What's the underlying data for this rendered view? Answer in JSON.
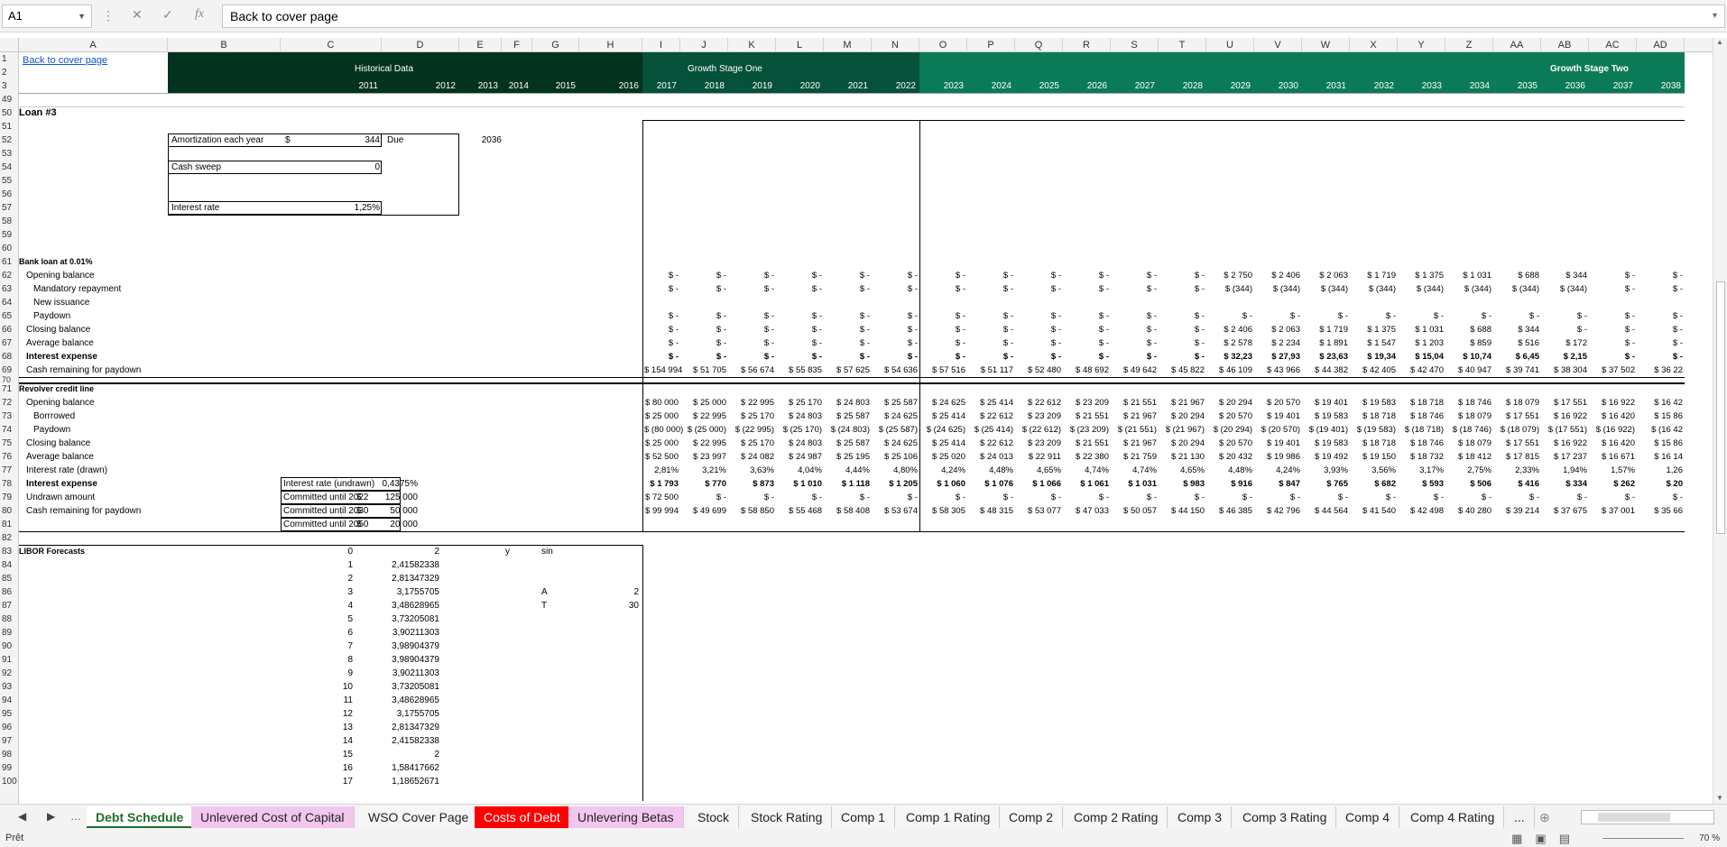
{
  "formula_bar": {
    "name_box": "A1",
    "formula": "Back to cover page"
  },
  "columns": [
    "A",
    "B",
    "C",
    "D",
    "E",
    "F",
    "G",
    "H",
    "I",
    "J",
    "K",
    "L",
    "M",
    "N",
    "O",
    "P",
    "Q",
    "R",
    "S",
    "T",
    "U",
    "V",
    "W",
    "X",
    "Y",
    "Z",
    "AA",
    "AB",
    "AC",
    "AD"
  ],
  "rows": [
    "1",
    "2",
    "3",
    "49",
    "50",
    "51",
    "52",
    "53",
    "54",
    "55",
    "56",
    "57",
    "58",
    "59",
    "60",
    "61",
    "62",
    "63",
    "64",
    "65",
    "66",
    "67",
    "68",
    "69",
    "70",
    "71",
    "72",
    "73",
    "74",
    "75",
    "76",
    "77",
    "78",
    "79",
    "80",
    "81",
    "82",
    "83",
    "84",
    "85",
    "86",
    "87",
    "88",
    "89",
    "90",
    "91",
    "92",
    "93",
    "94",
    "95",
    "96",
    "97",
    "98",
    "99",
    "100"
  ],
  "header": {
    "link": "Back to cover page",
    "historical": "Historical Data",
    "stage_one": "Growth Stage One",
    "stage_two": "Growth Stage Two",
    "years": [
      "2011",
      "2012",
      "2013",
      "2014",
      "2015",
      "2016",
      "2017",
      "2018",
      "2019",
      "2020",
      "2021",
      "2022",
      "2023",
      "2024",
      "2025",
      "2026",
      "2027",
      "2028",
      "2029",
      "2030",
      "2031",
      "2032",
      "2033",
      "2034",
      "2035",
      "2036",
      "2037",
      "2038"
    ]
  },
  "loan": {
    "title": "Loan #3",
    "amort_label": "Amortization each year",
    "amort_cur": "$",
    "amort_val": "344",
    "due_label": "Due",
    "due_val": "2036",
    "sweep_label": "Cash sweep",
    "sweep_val": "0",
    "rate_label": "Interest rate",
    "rate_val": "1,25%"
  },
  "bank": {
    "title": "Bank loan at 0.01%",
    "labels": [
      "Opening balance",
      "Mandatory repayment",
      "New issuance",
      "Paydown",
      "Closing balance",
      "Average balance",
      "Interest expense",
      "Cash remaining for paydown"
    ],
    "opening": [
      "$       -",
      "$       -",
      "$       -",
      "$       -",
      "$       -",
      "$       -",
      "$       -",
      "$       -",
      "$       -",
      "$       -",
      "$       -",
      "$       -",
      "$ 2 750",
      "$ 2 406",
      "$ 2 063",
      "$ 1 719",
      "$ 1 375",
      "$ 1 031",
      "$   688",
      "$   344",
      "$       -",
      "$       -"
    ],
    "mandatory": [
      "$       -",
      "$       -",
      "$       -",
      "$       -",
      "$       -",
      "$       -",
      "$       -",
      "$       -",
      "$       -",
      "$       -",
      "$       -",
      "$       -",
      "$  (344)",
      "$  (344)",
      "$  (344)",
      "$  (344)",
      "$  (344)",
      "$  (344)",
      "$  (344)",
      "$  (344)",
      "$       -",
      "$       -"
    ],
    "paydown": [
      "$       -",
      "$       -",
      "$       -",
      "$       -",
      "$       -",
      "$       -",
      "$       -",
      "$       -",
      "$       -",
      "$       -",
      "$       -",
      "$       -",
      "$       -",
      "$       -",
      "$       -",
      "$       -",
      "$       -",
      "$       -",
      "$       -",
      "$       -",
      "$       -",
      "$       -"
    ],
    "closing": [
      "$       -",
      "$       -",
      "$       -",
      "$       -",
      "$       -",
      "$       -",
      "$       -",
      "$       -",
      "$       -",
      "$       -",
      "$       -",
      "$       -",
      "$ 2 406",
      "$ 2 063",
      "$ 1 719",
      "$ 1 375",
      "$ 1 031",
      "$   688",
      "$   344",
      "$       -",
      "$       -",
      "$       -"
    ],
    "average": [
      "$       -",
      "$       -",
      "$       -",
      "$       -",
      "$       -",
      "$       -",
      "$       -",
      "$       -",
      "$       -",
      "$       -",
      "$       -",
      "$       -",
      "$ 2 578",
      "$ 2 234",
      "$ 1 891",
      "$ 1 547",
      "$ 1 203",
      "$   859",
      "$   516",
      "$   172",
      "$       -",
      "$       -"
    ],
    "interest": [
      "$       -",
      "$       -",
      "$       -",
      "$       -",
      "$       -",
      "$       -",
      "$       -",
      "$       -",
      "$       -",
      "$       -",
      "$       -",
      "$       -",
      "$ 32,23",
      "$ 27,93",
      "$ 23,63",
      "$ 19,34",
      "$ 15,04",
      "$ 10,74",
      "$  6,45",
      "$  2,15",
      "$       -",
      "$       -"
    ],
    "cash": [
      "$ 154 994",
      "$ 51 705",
      "$ 56 674",
      "$ 55 835",
      "$ 57 625",
      "$ 54 636",
      "$ 57 516",
      "$ 51 117",
      "$ 52 480",
      "$ 48 692",
      "$ 49 642",
      "$ 45 822",
      "$ 46 109",
      "$ 43 966",
      "$ 44 382",
      "$ 42 405",
      "$ 42 470",
      "$ 40 947",
      "$ 39 741",
      "$ 38 304",
      "$ 37 502",
      "$ 36 22"
    ]
  },
  "revolver": {
    "title": "Revolver credit line",
    "labels": [
      "Opening balance",
      "Borrrowed",
      "Paydown",
      "Closing balance",
      "Average balance",
      "Interest rate (drawn)",
      "Interest expense",
      "Undrawn amount",
      "Cash remaining for paydown"
    ],
    "opening": [
      "$ 80 000",
      "$ 25 000",
      "$ 22 995",
      "$ 25 170",
      "$ 24 803",
      "$ 25 587",
      "$ 24 625",
      "$ 25 414",
      "$ 22 612",
      "$ 23 209",
      "$ 21 551",
      "$ 21 967",
      "$ 20 294",
      "$ 20 570",
      "$ 19 401",
      "$ 19 583",
      "$ 18 718",
      "$ 18 746",
      "$ 18 079",
      "$ 17 551",
      "$ 16 922",
      "$ 16 42"
    ],
    "borrowed": [
      "$ 25 000",
      "$ 22 995",
      "$ 25 170",
      "$ 24 803",
      "$ 25 587",
      "$ 24 625",
      "$ 25 414",
      "$ 22 612",
      "$ 23 209",
      "$ 21 551",
      "$ 21 967",
      "$ 20 294",
      "$ 20 570",
      "$ 19 401",
      "$ 19 583",
      "$ 18 718",
      "$ 18 746",
      "$ 18 079",
      "$ 17 551",
      "$ 16 922",
      "$ 16 420",
      "$ 15 86"
    ],
    "paydown": [
      "$ (80 000)",
      "$ (25 000)",
      "$ (22 995)",
      "$ (25 170)",
      "$ (24 803)",
      "$ (25 587)",
      "$ (24 625)",
      "$ (25 414)",
      "$ (22 612)",
      "$ (23 209)",
      "$ (21 551)",
      "$ (21 967)",
      "$ (20 294)",
      "$ (20 570)",
      "$ (19 401)",
      "$ (19 583)",
      "$ (18 718)",
      "$ (18 746)",
      "$ (18 079)",
      "$ (17 551)",
      "$ (16 922)",
      "$ (16 42"
    ],
    "closing": [
      "$ 25 000",
      "$ 22 995",
      "$ 25 170",
      "$ 24 803",
      "$ 25 587",
      "$ 24 625",
      "$ 25 414",
      "$ 22 612",
      "$ 23 209",
      "$ 21 551",
      "$ 21 967",
      "$ 20 294",
      "$ 20 570",
      "$ 19 401",
      "$ 19 583",
      "$ 18 718",
      "$ 18 746",
      "$ 18 079",
      "$ 17 551",
      "$ 16 922",
      "$ 16 420",
      "$ 15 86"
    ],
    "average": [
      "$ 52 500",
      "$ 23 997",
      "$ 24 082",
      "$ 24 987",
      "$ 25 195",
      "$ 25 106",
      "$ 25 020",
      "$ 24 013",
      "$ 22 911",
      "$ 22 380",
      "$ 21 759",
      "$ 21 130",
      "$ 20 432",
      "$ 19 986",
      "$ 19 492",
      "$ 19 150",
      "$ 18 732",
      "$ 18 412",
      "$ 17 815",
      "$ 17 237",
      "$ 16 671",
      "$ 16 14"
    ],
    "rate": [
      "2,81%",
      "3,21%",
      "3,63%",
      "4,04%",
      "4,44%",
      "4,80%",
      "4,24%",
      "4,48%",
      "4,65%",
      "4,74%",
      "4,74%",
      "4,65%",
      "4,48%",
      "4,24%",
      "3,93%",
      "3,56%",
      "3,17%",
      "2,75%",
      "2,33%",
      "1,94%",
      "1,57%",
      "1,26"
    ],
    "interest": [
      "$ 1 793",
      "$   770",
      "$   873",
      "$ 1 010",
      "$ 1 118",
      "$ 1 205",
      "$ 1 060",
      "$ 1 076",
      "$ 1 066",
      "$ 1 061",
      "$ 1 031",
      "$   983",
      "$   916",
      "$   847",
      "$   765",
      "$   682",
      "$   593",
      "$   506",
      "$   416",
      "$   334",
      "$   262",
      "$ 20"
    ],
    "undrawn": [
      "$ 72 500",
      "$       -",
      "$       -",
      "$       -",
      "$       -",
      "$       -",
      "$       -",
      "$       -",
      "$       -",
      "$       -",
      "$       -",
      "$       -",
      "$       -",
      "$       -",
      "$       -",
      "$       -",
      "$       -",
      "$       -",
      "$       -",
      "$       -",
      "$       -",
      "$      -"
    ],
    "cash": [
      "$ 99 994",
      "$ 49 699",
      "$ 58 850",
      "$ 55 468",
      "$ 58 408",
      "$ 53 674",
      "$ 58 305",
      "$ 48 315",
      "$ 53 077",
      "$ 47 033",
      "$ 50 057",
      "$ 44 150",
      "$ 46 385",
      "$ 42 796",
      "$ 44 564",
      "$ 41 540",
      "$ 42 498",
      "$ 40 280",
      "$ 39 214",
      "$ 37 675",
      "$ 37 001",
      "$ 35 66"
    ],
    "side_labels": [
      "Interest rate (undrawn)",
      "Committed until 2022",
      "Committed until 2030",
      "Committed until 2050"
    ],
    "side_cur": [
      "",
      "$",
      "$",
      "$"
    ],
    "side_vals": [
      "0,4375%",
      "125 000",
      "50 000",
      "20 000"
    ]
  },
  "libor": {
    "title": "LIBOR Forecasts",
    "idx": [
      "0",
      "1",
      "2",
      "3",
      "4",
      "5",
      "6",
      "7",
      "8",
      "9",
      "10",
      "11",
      "12",
      "13",
      "14",
      "15",
      "16",
      "17"
    ],
    "vals": [
      "2",
      "2,41582338",
      "2,81347329",
      "3,1755705",
      "3,48628965",
      "3,73205081",
      "3,90211303",
      "3,98904379",
      "3,98904379",
      "3,90211303",
      "3,73205081",
      "3,48628965",
      "3,1755705",
      "2,81347329",
      "2,41582338",
      "2",
      "1,58417662",
      "1,18652671"
    ],
    "y": "y",
    "sin": "sin",
    "A": "A",
    "A_val": "2",
    "T": "T",
    "T_val": "30"
  },
  "tabs": [
    "Debt Schedule",
    "Unlevered Cost of Capital",
    "WSO Cover Page",
    "Costs of Debt",
    "Unlevering Betas",
    "Stock",
    "Stock Rating",
    "Comp 1",
    "Comp 1 Rating",
    "Comp 2",
    "Comp 2 Rating",
    "Comp 3",
    "Comp 3 Rating",
    "Comp 4",
    "Comp 4 Rating",
    "..."
  ],
  "tab_colors": {
    "pink": "#f3c6f0",
    "red": "#ff0000",
    "green_dark": "#03331e",
    "green_mid": "#05513a",
    "green_light": "#0b7a57"
  },
  "status": {
    "ready": "Prêt",
    "zoom": "70 %"
  }
}
